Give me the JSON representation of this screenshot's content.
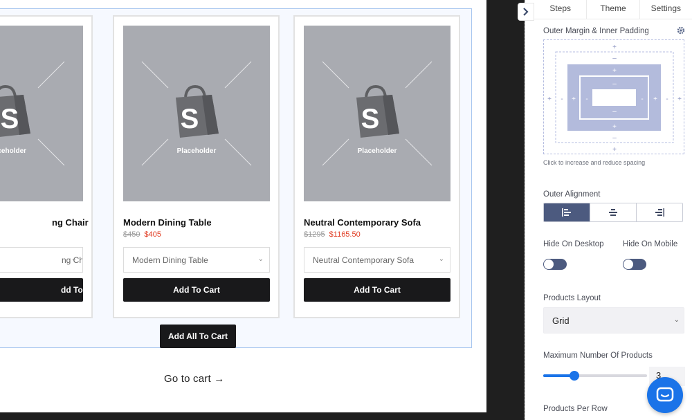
{
  "products": [
    {
      "title": "Dining Chair",
      "title_visible": "ng Chair",
      "old_price": "",
      "new_price": "",
      "variant": "ng Chair",
      "add_to_cart": "dd To Cart",
      "placeholder": "laceholder"
    },
    {
      "title": "Modern Dining Table",
      "old_price": "$450",
      "new_price": "$405",
      "variant": "Modern Dining Table",
      "add_to_cart": "Add To Cart",
      "placeholder": "Placeholder"
    },
    {
      "title": "Neutral Contemporary Sofa",
      "old_price": "$1295",
      "new_price": "$1165.50",
      "variant": "Neutral Contemporary Sofa",
      "add_to_cart": "Add To Cart",
      "placeholder": "Placeholder"
    }
  ],
  "bundle": {
    "add_all_label": "Add All To Cart",
    "go_to_cart": "Go to cart →"
  },
  "panel": {
    "tabs": [
      "Steps",
      "Theme",
      "Settings"
    ],
    "spacing_title": "Outer Margin & Inner Padding",
    "spacing_help": "Click to increase and reduce spacing",
    "outer_alignment": "Outer Alignment",
    "hide_on_desktop": "Hide On Desktop",
    "hide_on_mobile": "Hide On Mobile",
    "products_layout_label": "Products Layout",
    "products_layout_value": "Grid",
    "max_products_label": "Maximum Number Of Products",
    "max_products_value": "3",
    "max_products_slider_fraction": 0.3,
    "products_per_row_label": "Products Per Row"
  },
  "colors": {
    "accent": "#1a73e8",
    "button_dark": "#19191b",
    "sale_price": "#e0391f",
    "active_segment": "#4c5a7f"
  },
  "icons": {
    "toggle_panel": "chevron-right-icon",
    "settings": "gear-icon",
    "chat": "chat-icon",
    "product_image": "shopify-bag-icon"
  }
}
